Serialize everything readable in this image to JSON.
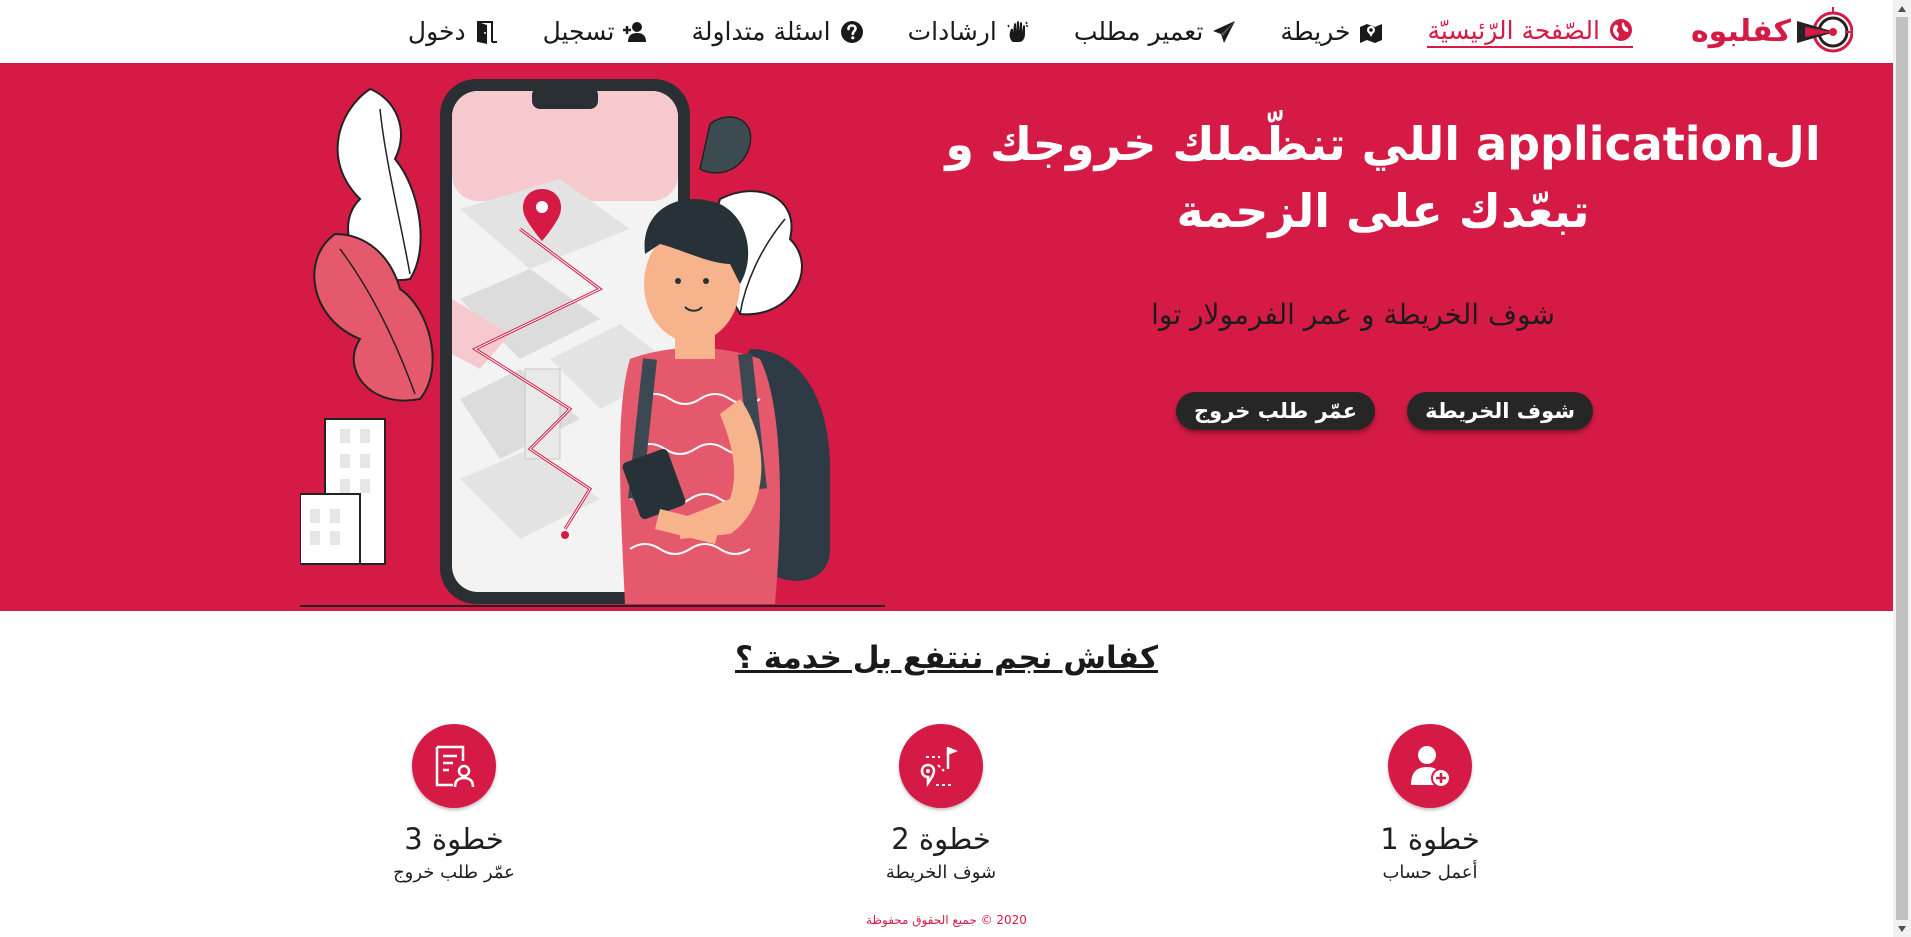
{
  "brand": {
    "name": "كفلبوه"
  },
  "nav": {
    "items": [
      {
        "label": "الصّفحة الرّئيسيّة",
        "icon": "globe-icon",
        "active": true
      },
      {
        "label": "خريطة",
        "icon": "map-icon",
        "active": false
      },
      {
        "label": "تعمير مطلب",
        "icon": "paper-plane-icon",
        "active": false
      },
      {
        "label": "ارشادات",
        "icon": "hand-icon",
        "active": false
      },
      {
        "label": "اسئلة متداولة",
        "icon": "question-circle-icon",
        "active": false
      },
      {
        "label": "تسجيل",
        "icon": "user-plus-icon",
        "active": false
      },
      {
        "label": "دخول",
        "icon": "door-icon",
        "active": false
      }
    ]
  },
  "hero": {
    "title": "الapplication اللي تنظّملك خروجك و تبعّدك على الزحمة",
    "subtitle": "شوف الخريطة و عمر الفرمولار توا",
    "buttons": {
      "map": "شوف الخريطة",
      "request": "عمّر طلب خروج"
    }
  },
  "steps": {
    "title": "كفاش نجم ننتفع بل خدمة ؟",
    "items": [
      {
        "title": "خطوة 1",
        "desc": "أعمل حساب",
        "icon": "user-add-icon"
      },
      {
        "title": "خطوة 2",
        "desc": "شوف الخريطة",
        "icon": "map-route-icon"
      },
      {
        "title": "خطوة 3",
        "desc": "عمّر طلب خروج",
        "icon": "form-user-icon"
      }
    ]
  },
  "footer": {
    "text": "2020 © جميع الحقوق محفوظة"
  },
  "colors": {
    "primary": "#d51b45",
    "dark": "#262626",
    "white": "#ffffff"
  }
}
